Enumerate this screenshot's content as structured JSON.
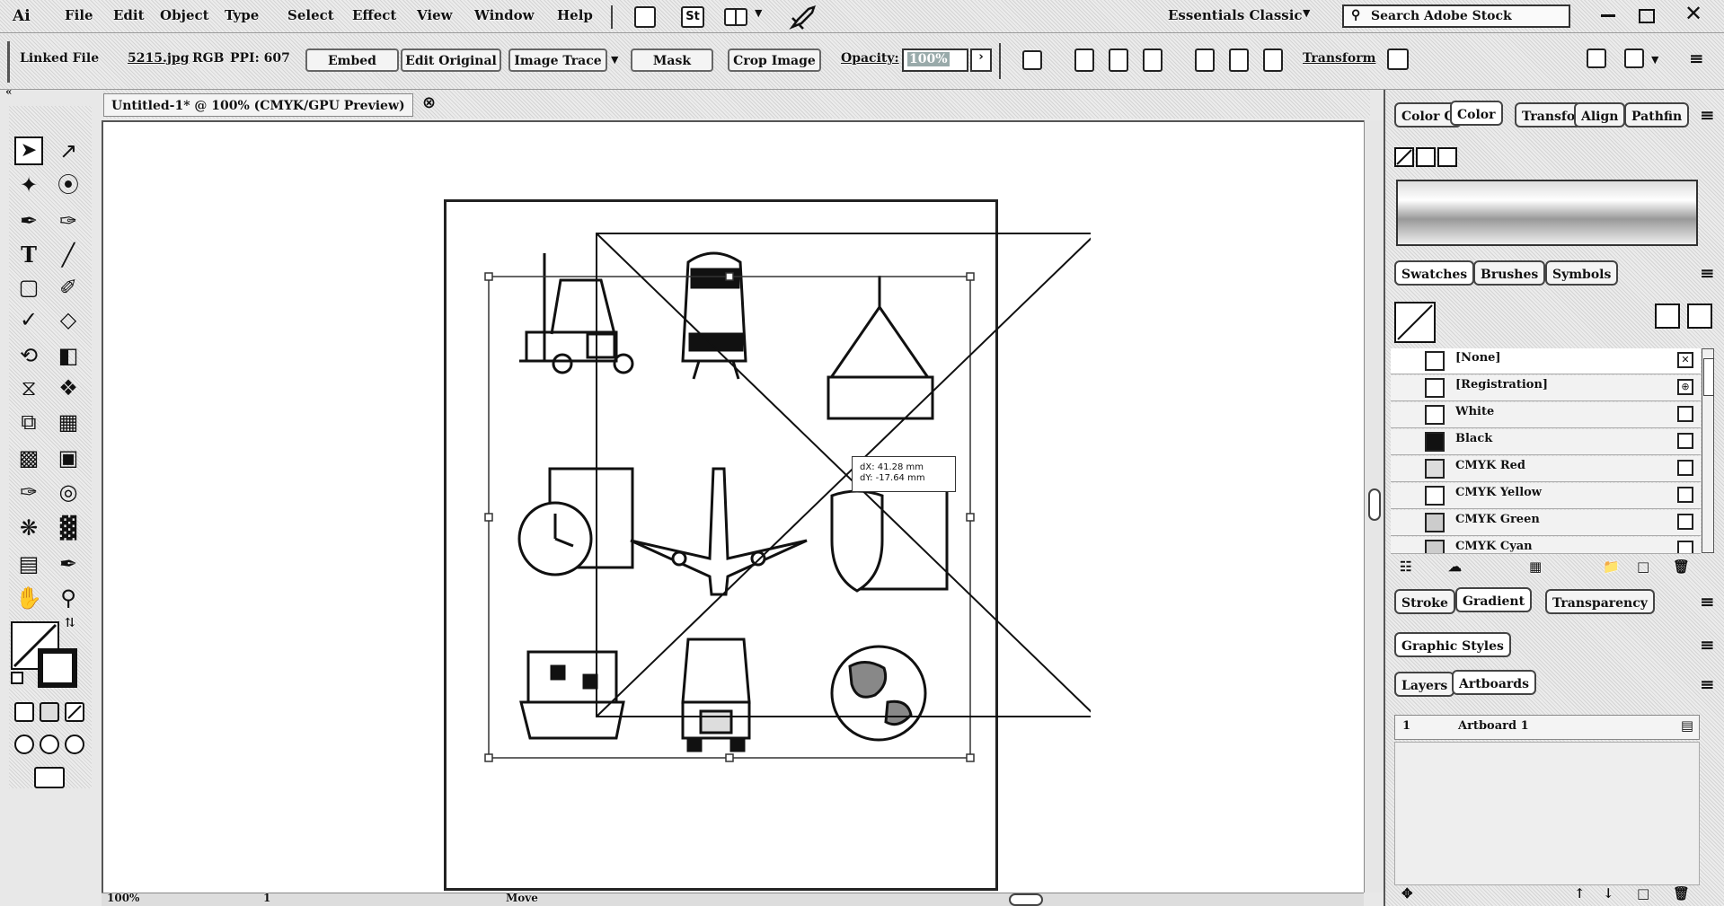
{
  "app": {
    "logo": "Ai"
  },
  "menu": [
    "File",
    "Edit",
    "Object",
    "Type",
    "Select",
    "Effect",
    "View",
    "Window",
    "Help"
  ],
  "header": {
    "st_label": "St",
    "workspace": "Essentials Classic",
    "search_placeholder": "Search Adobe Stock"
  },
  "control": {
    "linked_file": "Linked File",
    "file_name": "5215.jpg",
    "color_mode": "RGB",
    "ppi": "PPI: 607",
    "embed": "Embed",
    "edit_original": "Edit Original",
    "image_trace": "Image Trace",
    "mask": "Mask",
    "crop_image": "Crop Image",
    "opacity_label": "Opacity:",
    "opacity_value": "100%",
    "transform": "Transform"
  },
  "document": {
    "tab_title": "Untitled-1* @ 100% (CMYK/GPU Preview)"
  },
  "canvas": {
    "tooltip_dx": "dX: 41.28 mm",
    "tooltip_dy": "dY: -17.64 mm"
  },
  "panels": {
    "top_tabs": [
      "Color G",
      "Color",
      "Transfo",
      "Align",
      "Pathfin"
    ],
    "swatch_tabs": [
      "Swatches",
      "Brushes",
      "Symbols"
    ],
    "swatches": [
      "[None]",
      "[Registration]",
      "White",
      "Black",
      "CMYK Red",
      "CMYK Yellow",
      "CMYK Green",
      "CMYK Cyan"
    ],
    "grad_tabs": [
      "Stroke",
      "Gradient",
      "Transparency"
    ],
    "graphic_styles": "Graphic Styles",
    "layer_tabs": [
      "Layers",
      "Artboards"
    ],
    "artboard_number": "1",
    "artboard_name": "Artboard 1"
  },
  "status": {
    "zoom": "100%",
    "page": "1",
    "mode": "Move"
  }
}
